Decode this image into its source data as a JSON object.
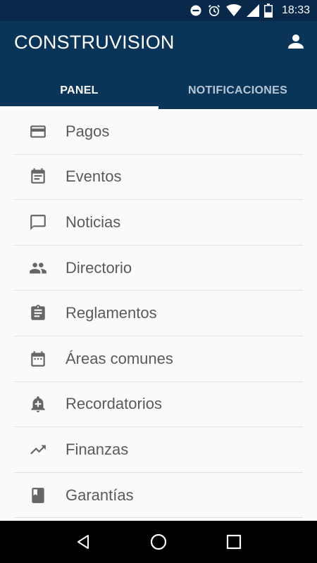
{
  "status_bar": {
    "time": "18:33",
    "icons": [
      "do-not-disturb-icon",
      "alarm-icon",
      "wifi-icon",
      "signal-icon",
      "battery-icon"
    ]
  },
  "app_bar": {
    "title": "CONSTRUVISION",
    "account_icon": "account-icon",
    "background_color": "#0a3558"
  },
  "tabs": [
    {
      "label": "PANEL",
      "active": true
    },
    {
      "label": "NOTIFICACIONES",
      "active": false
    }
  ],
  "menu": {
    "items": [
      {
        "label": "Pagos",
        "icon": "credit-card-icon"
      },
      {
        "label": "Eventos",
        "icon": "event-calendar-icon"
      },
      {
        "label": "Noticias",
        "icon": "chat-bubble-icon"
      },
      {
        "label": "Directorio",
        "icon": "people-icon"
      },
      {
        "label": "Reglamentos",
        "icon": "clipboard-icon"
      },
      {
        "label": "Áreas comunes",
        "icon": "calendar-icon"
      },
      {
        "label": "Recordatorios",
        "icon": "bell-plus-icon"
      },
      {
        "label": "Finanzas",
        "icon": "trending-up-icon"
      },
      {
        "label": "Garantías",
        "icon": "book-icon"
      }
    ]
  },
  "nav_bar": {
    "buttons": [
      "back-icon",
      "home-icon",
      "recents-icon"
    ]
  }
}
